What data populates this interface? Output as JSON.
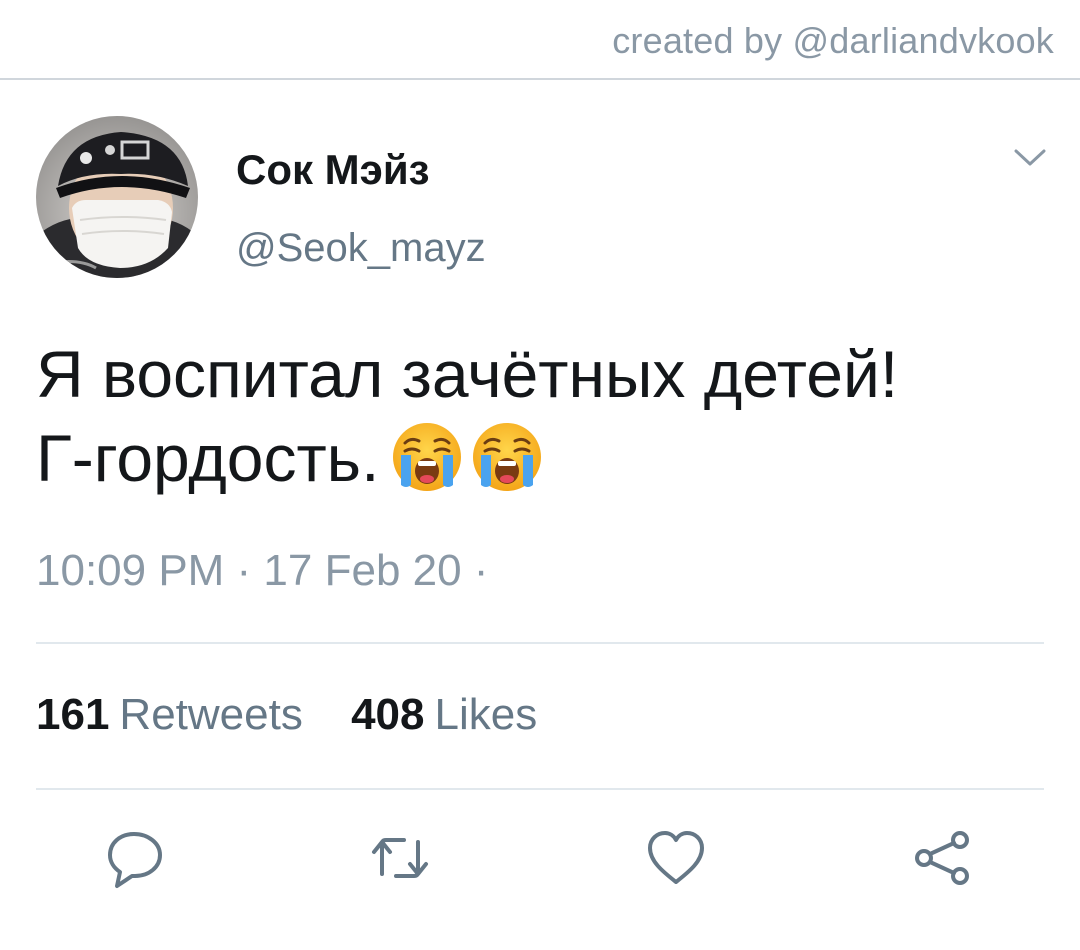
{
  "credit": {
    "text": "created by @darliandvkook"
  },
  "tweet": {
    "author": {
      "display_name": "Сок Мэйз",
      "handle": "@Seok_mayz"
    },
    "text_lines": [
      "Я воспитал зачётных детей!",
      "Г-гордость."
    ],
    "emojis": [
      "loudly-crying-face",
      "loudly-crying-face"
    ],
    "meta": "10:09 PM · 17 Feb 20 ·",
    "stats": {
      "retweets_count": "161",
      "retweets_label": "Retweets",
      "likes_count": "408",
      "likes_label": "Likes"
    }
  },
  "actions": {
    "icons": [
      "reply-icon",
      "retweet-icon",
      "like-icon",
      "share-icon"
    ]
  },
  "colors": {
    "text_primary": "#14171a",
    "text_secondary": "#657786",
    "icon_gray": "#657786",
    "divider": "#e1e8ed"
  }
}
